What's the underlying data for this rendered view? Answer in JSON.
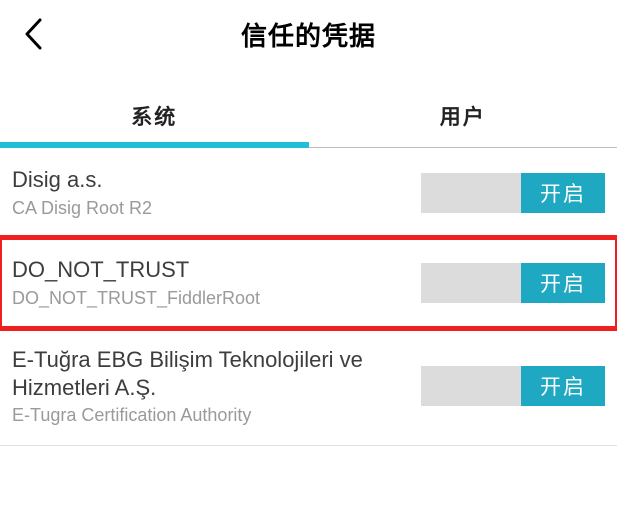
{
  "header": {
    "title": "信任的凭据"
  },
  "tabs": {
    "system": "系统",
    "user": "用户",
    "activeIndex": 0
  },
  "toggle_on_label": "开启",
  "certificates": [
    {
      "title": "Disig a.s.",
      "subtitle": "CA Disig Root R2",
      "enabled": true,
      "highlight": false
    },
    {
      "title": "DO_NOT_TRUST",
      "subtitle": "DO_NOT_TRUST_FiddlerRoot",
      "enabled": true,
      "highlight": true
    },
    {
      "title": "E-Tuğra EBG Bilişim Teknolojileri ve Hizmetleri A.Ş.",
      "subtitle": "E-Tugra Certification Authority",
      "enabled": true,
      "highlight": false
    }
  ]
}
